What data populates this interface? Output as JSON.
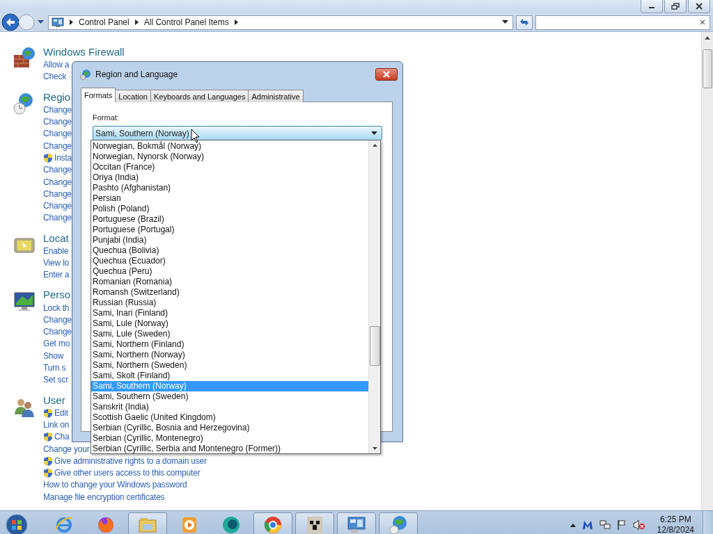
{
  "address": {
    "crumbs": [
      "Control Panel",
      "All Control Panel Items"
    ]
  },
  "sections": [
    {
      "title": "Windows Firewall",
      "links": [
        {
          "text": "Allow a",
          "shield": false
        },
        {
          "text": "Check",
          "shield": false
        }
      ]
    },
    {
      "title": "Regio",
      "links": [
        {
          "text": "Change",
          "shield": false
        },
        {
          "text": "Change",
          "shield": false
        },
        {
          "text": "Change",
          "shield": false
        },
        {
          "text": "Change",
          "shield": false
        },
        {
          "text": "Insta",
          "shield": true
        },
        {
          "text": "Change",
          "shield": false
        },
        {
          "text": "Change",
          "shield": false
        },
        {
          "text": "Change",
          "shield": false
        },
        {
          "text": "Change",
          "shield": false
        },
        {
          "text": "Change",
          "shield": false
        }
      ]
    },
    {
      "title": "Locat",
      "links": [
        {
          "text": "Enable",
          "shield": false
        },
        {
          "text": "View lo",
          "shield": false
        },
        {
          "text": "Enter a",
          "shield": false
        }
      ]
    },
    {
      "title": "Perso",
      "links": [
        {
          "text": "Lock th",
          "shield": false
        },
        {
          "text": "Change",
          "shield": false
        },
        {
          "text": "Change",
          "shield": false
        },
        {
          "text": "Get mo",
          "shield": false
        },
        {
          "text": "Show",
          "shield": false
        },
        {
          "text": "Turn s",
          "shield": false
        },
        {
          "text": "Set scr",
          "shield": false
        }
      ]
    },
    {
      "title": "User",
      "links": [
        {
          "text": "Edit",
          "shield": true
        },
        {
          "text": "Link on",
          "shield": false
        },
        {
          "text": "Cha",
          "shield": true
        },
        {
          "text": "Change your",
          "shield": false
        },
        {
          "text": "Give administrative rights to a domain user",
          "shield": true
        },
        {
          "text": "Give other users access to this computer",
          "shield": true
        },
        {
          "text": "How to change your Windows password",
          "shield": false
        },
        {
          "text": "Manage file encryption certificates",
          "shield": false
        }
      ]
    }
  ],
  "dialog": {
    "title": "Region and Language",
    "tabs": [
      {
        "label": "Formats",
        "selected": true
      },
      {
        "label": "Location",
        "selected": false
      },
      {
        "label": "Keyboards and Languages",
        "selected": false
      },
      {
        "label": "Administrative",
        "selected": false
      }
    ],
    "format_label": "Format:",
    "format_value": "Sami, Southern (Norway)",
    "options": [
      {
        "text": "Norwegian, Bokmål (Norway)",
        "selected": false
      },
      {
        "text": "Norwegian, Nynorsk (Norway)",
        "selected": false
      },
      {
        "text": "Occitan (France)",
        "selected": false
      },
      {
        "text": "Oriya (India)",
        "selected": false
      },
      {
        "text": "Pashto (Afghanistan)",
        "selected": false
      },
      {
        "text": "Persian",
        "selected": false
      },
      {
        "text": "Polish (Poland)",
        "selected": false
      },
      {
        "text": "Portuguese (Brazil)",
        "selected": false
      },
      {
        "text": "Portuguese (Portugal)",
        "selected": false
      },
      {
        "text": "Punjabi (India)",
        "selected": false
      },
      {
        "text": "Quechua (Bolivia)",
        "selected": false
      },
      {
        "text": "Quechua (Ecuador)",
        "selected": false
      },
      {
        "text": "Quechua (Peru)",
        "selected": false
      },
      {
        "text": "Romanian (Romania)",
        "selected": false
      },
      {
        "text": "Romansh (Switzerland)",
        "selected": false
      },
      {
        "text": "Russian (Russia)",
        "selected": false
      },
      {
        "text": "Sami, Inari (Finland)",
        "selected": false
      },
      {
        "text": "Sami, Lule (Norway)",
        "selected": false
      },
      {
        "text": "Sami, Lule (Sweden)",
        "selected": false
      },
      {
        "text": "Sami, Northern (Finland)",
        "selected": false
      },
      {
        "text": "Sami, Northern (Norway)",
        "selected": false
      },
      {
        "text": "Sami, Northern (Sweden)",
        "selected": false
      },
      {
        "text": "Sami, Skolt (Finland)",
        "selected": false
      },
      {
        "text": "Sami, Southern (Norway)",
        "selected": true
      },
      {
        "text": "Sami, Southern (Sweden)",
        "selected": false
      },
      {
        "text": "Sanskrit (India)",
        "selected": false
      },
      {
        "text": "Scottish Gaelic (United Kingdom)",
        "selected": false
      },
      {
        "text": "Serbian (Cyrillic, Bosnia and Herzegovina)",
        "selected": false
      },
      {
        "text": "Serbian (Cyrillic, Montenegro)",
        "selected": false
      },
      {
        "text": "Serbian (Cyrillic, Serbia and Montenegro (Former))",
        "selected": false
      }
    ]
  },
  "taskbar": {
    "apps": [
      {
        "kind": "ie",
        "open": false
      },
      {
        "kind": "firefox",
        "open": false
      },
      {
        "kind": "explorer",
        "open": true
      },
      {
        "kind": "media",
        "open": false
      },
      {
        "kind": "orb",
        "open": false
      },
      {
        "kind": "chrome",
        "open": true
      },
      {
        "kind": "blockface",
        "open": true
      },
      {
        "kind": "controlpanel",
        "open": true
      },
      {
        "kind": "globe",
        "open": true
      }
    ],
    "time": "6:25 PM",
    "date": "12/8/2024"
  }
}
